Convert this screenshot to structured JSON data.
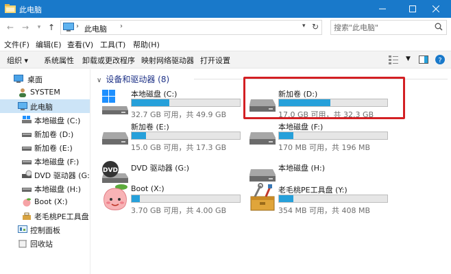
{
  "window": {
    "title": "此电脑"
  },
  "address": {
    "crumb": "此电脑",
    "search_placeholder": "搜索\"此电脑\""
  },
  "menu": {
    "file": "文件(F)",
    "edit": "编辑(E)",
    "view": "查看(V)",
    "tools": "工具(T)",
    "help": "帮助(H)"
  },
  "toolbar": {
    "organize": "组织 ▾",
    "system_props": "系统属性",
    "uninstall": "卸载或更改程序",
    "map_drive": "映射网络驱动器",
    "open_settings": "打开设置"
  },
  "sidebar": {
    "items": [
      {
        "label": "桌面"
      },
      {
        "label": "SYSTEM"
      },
      {
        "label": "此电脑"
      },
      {
        "label": "本地磁盘 (C:)"
      },
      {
        "label": "新加卷 (D:)"
      },
      {
        "label": "新加卷 (E:)"
      },
      {
        "label": "本地磁盘 (F:)"
      },
      {
        "label": "DVD 驱动器 (G:)"
      },
      {
        "label": "本地磁盘 (H:)"
      },
      {
        "label": "Boot (X:)"
      },
      {
        "label": "老毛桃PE工具盘 ("
      },
      {
        "label": "控制面板"
      },
      {
        "label": "回收站"
      }
    ]
  },
  "content": {
    "group_title": "设备和驱动器 (8)",
    "drives": [
      {
        "name": "本地磁盘 (C:)",
        "info": "32.7 GB 可用，共 49.9 GB",
        "used_fraction": 0.345,
        "icon": "windows-drive-icon"
      },
      {
        "name": "新加卷 (D:)",
        "info": "17.0 GB 可用，共 32.3 GB",
        "used_fraction": 0.474,
        "icon": "hard-drive-icon"
      },
      {
        "name": "新加卷 (E:)",
        "info": "15.0 GB 可用，共 17.3 GB",
        "used_fraction": 0.133,
        "icon": "hard-drive-icon"
      },
      {
        "name": "本地磁盘 (F:)",
        "info": "170 MB 可用，共 196 MB",
        "used_fraction": 0.133,
        "icon": "hard-drive-icon"
      },
      {
        "name": "DVD 驱动器 (G:)",
        "info": "",
        "used_fraction": null,
        "icon": "dvd-drive-icon"
      },
      {
        "name": "本地磁盘 (H:)",
        "info": "",
        "used_fraction": null,
        "icon": "hard-drive-icon"
      },
      {
        "name": "Boot (X:)",
        "info": "3.70 GB 可用，共 4.00 GB",
        "used_fraction": 0.075,
        "icon": "peach-icon"
      },
      {
        "name": "老毛桃PE工具盘 (Y:)",
        "info": "354 MB 可用，共 408 MB",
        "used_fraction": 0.132,
        "icon": "toolbox-icon"
      }
    ]
  },
  "colors": {
    "titlebar": "#1979ca",
    "accent_bar": "#26a0da",
    "highlight": "#d31f23",
    "selection": "#cce4f7"
  }
}
